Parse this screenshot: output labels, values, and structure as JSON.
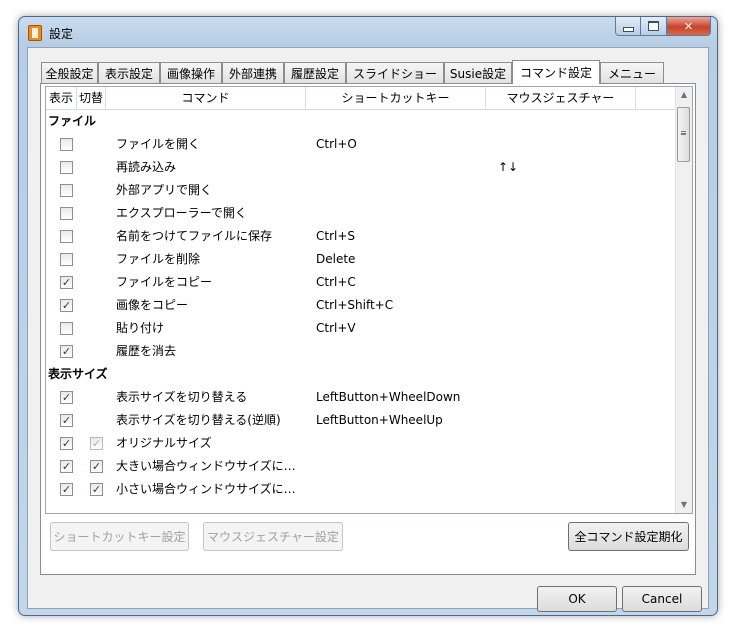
{
  "window": {
    "title": "設定"
  },
  "tabs": [
    {
      "label": "全般設定"
    },
    {
      "label": "表示設定"
    },
    {
      "label": "画像操作"
    },
    {
      "label": "外部連携"
    },
    {
      "label": "履歴設定"
    },
    {
      "label": "スライドショー"
    },
    {
      "label": "Susie設定"
    },
    {
      "label": "コマンド設定"
    },
    {
      "label": "メニュー"
    }
  ],
  "active_tab": "コマンド設定",
  "columns": {
    "show": "表示",
    "toggle": "切替",
    "command": "コマンド",
    "shortcut": "ショートカットキー",
    "gesture": "マウスジェスチャー"
  },
  "groups": [
    {
      "name": "ファイル",
      "items": [
        {
          "command": "ファイルを開く",
          "shortcut": "Ctrl+O",
          "gesture": "",
          "show_mark": "",
          "toggle_mark": ""
        },
        {
          "command": "再読み込み",
          "shortcut": "",
          "gesture": "↑↓",
          "show_mark": "",
          "toggle_mark": ""
        },
        {
          "command": "外部アプリで開く",
          "shortcut": "",
          "gesture": "",
          "show_mark": "",
          "toggle_mark": ""
        },
        {
          "command": "エクスプローラーで開く",
          "shortcut": "",
          "gesture": "",
          "show_mark": "",
          "toggle_mark": ""
        },
        {
          "command": "名前をつけてファイルに保存",
          "shortcut": "Ctrl+S",
          "gesture": "",
          "show_mark": "",
          "toggle_mark": ""
        },
        {
          "command": "ファイルを削除",
          "shortcut": "Delete",
          "gesture": "",
          "show_mark": "",
          "toggle_mark": ""
        },
        {
          "command": "ファイルをコピー",
          "shortcut": "Ctrl+C",
          "gesture": "",
          "show_mark": "✓",
          "toggle_mark": ""
        },
        {
          "command": "画像をコピー",
          "shortcut": "Ctrl+Shift+C",
          "gesture": "",
          "show_mark": "✓",
          "toggle_mark": ""
        },
        {
          "command": "貼り付け",
          "shortcut": "Ctrl+V",
          "gesture": "",
          "show_mark": "",
          "toggle_mark": ""
        },
        {
          "command": "履歴を消去",
          "shortcut": "",
          "gesture": "",
          "show_mark": "✓",
          "toggle_mark": ""
        }
      ]
    },
    {
      "name": "表示サイズ",
      "items": [
        {
          "command": "表示サイズを切り替える",
          "shortcut": "LeftButton+WheelDown",
          "gesture": "",
          "show_mark": "✓",
          "toggle_mark": ""
        },
        {
          "command": "表示サイズを切り替える(逆順)",
          "shortcut": "LeftButton+WheelUp",
          "gesture": "",
          "show_mark": "✓",
          "toggle_mark": ""
        },
        {
          "command": "オリジナルサイズ",
          "shortcut": "",
          "gesture": "",
          "show_mark": "✓",
          "toggle_mark": "✓"
        },
        {
          "command": "大きい場合ウィンドウサイズに…",
          "shortcut": "",
          "gesture": "",
          "show_mark": "✓",
          "toggle_mark": "✓"
        },
        {
          "command": "小さい場合ウィンドウサイズに…",
          "shortcut": "",
          "gesture": "",
          "show_mark": "✓",
          "toggle_mark": "✓"
        }
      ]
    }
  ],
  "buttons": {
    "shortcut_settings": "ショートカットキー設定",
    "gesture_settings": "マウスジェスチャー設定",
    "reset_all": "全コマンド設定期化",
    "ok": "OK",
    "cancel": "Cancel"
  }
}
